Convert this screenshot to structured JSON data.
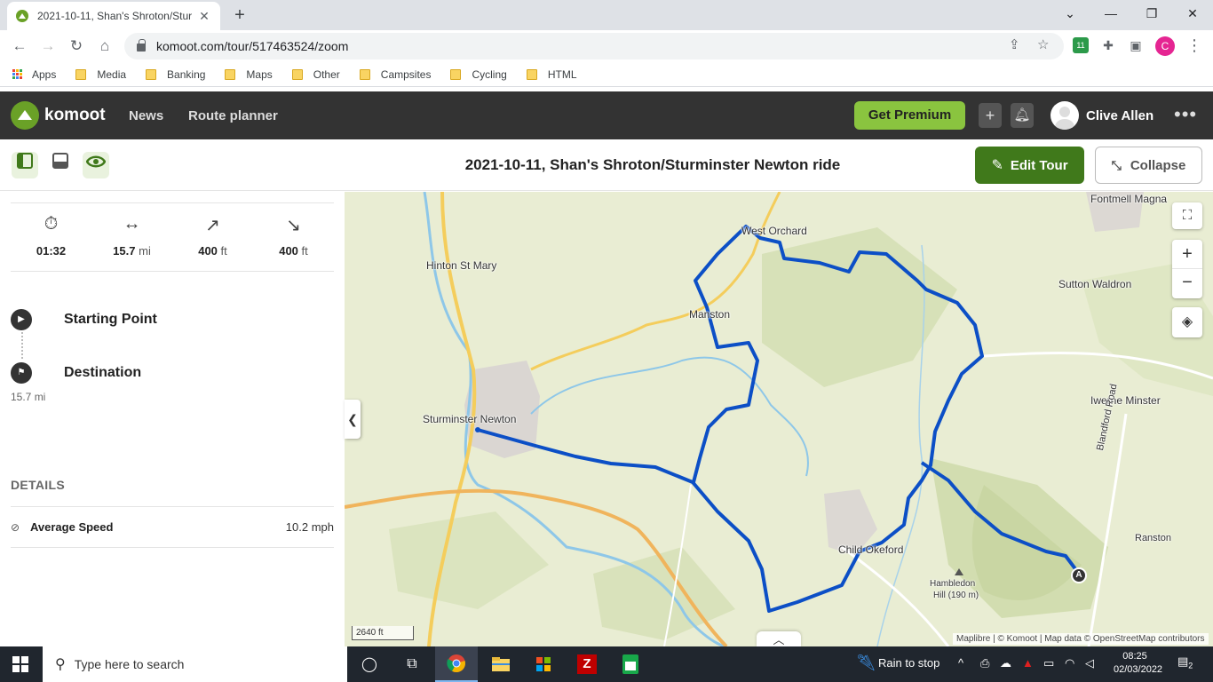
{
  "browser": {
    "tab_title": "2021-10-11, Shan's Shroton/Stur",
    "url": "komoot.com/tour/517463524/zoom",
    "profile_initial": "C",
    "extension_badge": "11",
    "bookmarks": [
      {
        "label": "Apps",
        "type": "apps"
      },
      {
        "label": "Media",
        "type": "folder"
      },
      {
        "label": "Banking",
        "type": "folder"
      },
      {
        "label": "Maps",
        "type": "folder"
      },
      {
        "label": "Other",
        "type": "folder"
      },
      {
        "label": "Campsites",
        "type": "folder"
      },
      {
        "label": "Cycling",
        "type": "folder"
      },
      {
        "label": "HTML",
        "type": "folder"
      }
    ]
  },
  "header": {
    "brand": "komoot",
    "nav": [
      "News",
      "Route planner"
    ],
    "premium_label": "Get Premium",
    "user_name": "Clive Allen",
    "brand_color": "#6aa127"
  },
  "tour": {
    "title": "2021-10-11, Shan's Shroton/Sturminster Newton ride",
    "edit_label": "Edit Tour",
    "collapse_label": "Collapse"
  },
  "stats": [
    {
      "icon": "stopwatch-icon",
      "value": "01:32",
      "unit": ""
    },
    {
      "icon": "distance-icon",
      "value": "15.7",
      "unit": "mi"
    },
    {
      "icon": "uphill-icon",
      "value": "400",
      "unit": "ft"
    },
    {
      "icon": "downhill-icon",
      "value": "400",
      "unit": "ft"
    }
  ],
  "waypoints": {
    "start_label": "Starting Point",
    "destination_label": "Destination",
    "destination_distance": "15.7 mi"
  },
  "details": {
    "heading": "DETAILS",
    "average_speed_label": "Average Speed",
    "average_speed_value": "10.2 mph"
  },
  "map": {
    "places": [
      "Fontmell Magna",
      "West Orchard",
      "Hinton St Mary",
      "Sutton Waldron",
      "Manston",
      "Iwerne Minster",
      "Sturminster Newton",
      "Blandford Road",
      "Ranston",
      "Child Okeford",
      "Hambledon",
      "Hill (190 m)"
    ],
    "start_marker": "A",
    "scale": "2640 ft",
    "attribution": "Maplibre | © Komoot | Map data © OpenStreetMap contributors",
    "route_color": "#0c4fc6"
  },
  "taskbar": {
    "search_placeholder": "Type here to search",
    "weather": "Rain to stop",
    "time": "08:25",
    "date": "02/03/2022",
    "notification_count": "2"
  }
}
